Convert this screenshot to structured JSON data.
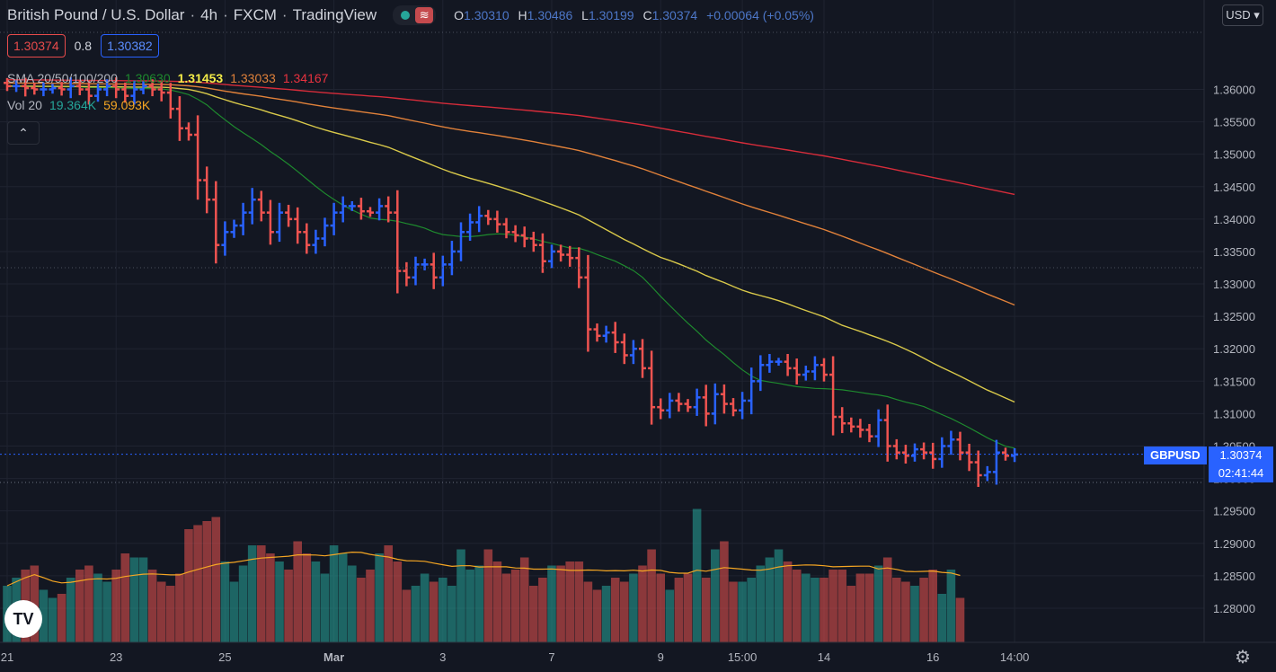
{
  "header": {
    "symbol": "British Pound / U.S. Dollar",
    "interval": "4h",
    "broker": "FXCM",
    "platform": "TradingView",
    "ohlc": {
      "o": "1.30310",
      "h": "1.30486",
      "l": "1.30199",
      "c": "1.30374",
      "change": "+0.00064 (+0.05%)"
    }
  },
  "quote": {
    "bid": "1.30374",
    "spread": "0.8",
    "ask": "1.30382"
  },
  "indicators": {
    "sma_label": "SMA 20/50/100/200",
    "sma_values": [
      "1.30630",
      "1.31453",
      "1.33033",
      "1.34167"
    ],
    "vol_label": "Vol 20",
    "vol_values": [
      "19.364K",
      "59.093K"
    ]
  },
  "currency": "USD",
  "last_price": {
    "ticker": "GBPUSD",
    "price": "1.30374",
    "countdown": "02:41:44"
  },
  "colors": {
    "up": "#2962ff",
    "down": "#ef5350",
    "vol_up": "#26a69a",
    "vol_down": "#ef5350",
    "sma20": "#1e8a2e",
    "sma50": "#d9c94a",
    "sma100": "#e0813a",
    "sma200": "#d62c3a",
    "vol_ma": "#f5a623"
  },
  "icons": {
    "collapse": "chevron-up-icon",
    "logo": "tradingview-logo-icon",
    "settings": "gear-icon"
  },
  "chart_data": {
    "type": "ohlc",
    "ylim": [
      1.2775,
      1.3645
    ],
    "y_ticks": [
      1.36,
      1.355,
      1.35,
      1.345,
      1.34,
      1.335,
      1.33,
      1.325,
      1.32,
      1.315,
      1.31,
      1.305,
      1.3,
      1.295,
      1.29,
      1.285,
      1.28
    ],
    "x_ticks": [
      {
        "label": "21",
        "i": 0
      },
      {
        "label": "23",
        "i": 12
      },
      {
        "label": "25",
        "i": 24
      },
      {
        "label": "Mar",
        "i": 36
      },
      {
        "label": "3",
        "i": 48
      },
      {
        "label": "7",
        "i": 60
      },
      {
        "label": "9",
        "i": 72
      },
      {
        "label": "15:00",
        "i": 81
      },
      {
        "label": "14",
        "i": 90
      },
      {
        "label": "16",
        "i": 102
      },
      {
        "label": "14:00",
        "i": 111
      }
    ],
    "close": [
      1.3605,
      1.3605,
      1.3602,
      1.36,
      1.36,
      1.3602,
      1.36,
      1.3605,
      1.36,
      1.359,
      1.36,
      1.3605,
      1.36,
      1.359,
      1.36,
      1.3605,
      1.36,
      1.3595,
      1.357,
      1.354,
      1.353,
      1.346,
      1.343,
      1.336,
      1.338,
      1.339,
      1.341,
      1.343,
      1.341,
      1.338,
      1.341,
      1.34,
      1.338,
      1.336,
      1.337,
      1.339,
      1.341,
      1.342,
      1.342,
      1.3412,
      1.341,
      1.342,
      1.341,
      1.332,
      1.331,
      1.333,
      1.333,
      1.331,
      1.333,
      1.335,
      1.338,
      1.3395,
      1.3405,
      1.34,
      1.3392,
      1.338,
      1.3375,
      1.337,
      1.336,
      1.3335,
      1.335,
      1.3345,
      1.334,
      1.331,
      1.323,
      1.322,
      1.3225,
      1.321,
      1.319,
      1.32,
      1.317,
      1.311,
      1.3105,
      1.312,
      1.3115,
      1.311,
      1.3125,
      1.31,
      1.313,
      1.3115,
      1.3105,
      1.312,
      1.315,
      1.3175,
      1.318,
      1.318,
      1.317,
      1.316,
      1.3165,
      1.3175,
      1.316,
      1.3095,
      1.3085,
      1.308,
      1.3075,
      1.3065,
      1.309,
      1.305,
      1.304,
      1.3035,
      1.3045,
      1.304,
      1.303,
      1.305,
      1.306,
      1.304,
      1.3025,
      1.3005,
      1.301,
      1.304,
      1.3035,
      1.3037
    ],
    "volume": [
      14,
      16,
      18,
      19,
      13,
      11,
      12,
      16,
      18,
      19,
      17,
      15,
      18,
      22,
      21,
      21,
      18,
      15,
      14,
      17,
      28,
      29,
      30,
      31,
      20,
      15,
      19,
      24,
      24,
      22,
      20,
      18,
      25,
      22,
      20,
      17,
      24,
      22,
      19,
      16,
      18,
      22,
      24,
      20,
      13,
      14,
      17,
      15,
      16,
      14,
      23,
      18,
      19,
      23,
      20,
      17,
      18,
      21,
      14,
      16,
      19,
      19,
      20,
      20,
      15,
      13,
      14,
      16,
      15,
      17,
      19,
      23,
      17,
      13,
      16,
      17,
      33,
      16,
      23,
      25,
      15,
      15,
      16,
      19,
      21,
      23,
      20,
      18,
      17,
      16,
      16,
      18,
      18,
      14,
      17,
      17,
      19,
      21,
      16,
      15,
      14,
      16,
      18,
      12,
      18,
      11
    ]
  }
}
